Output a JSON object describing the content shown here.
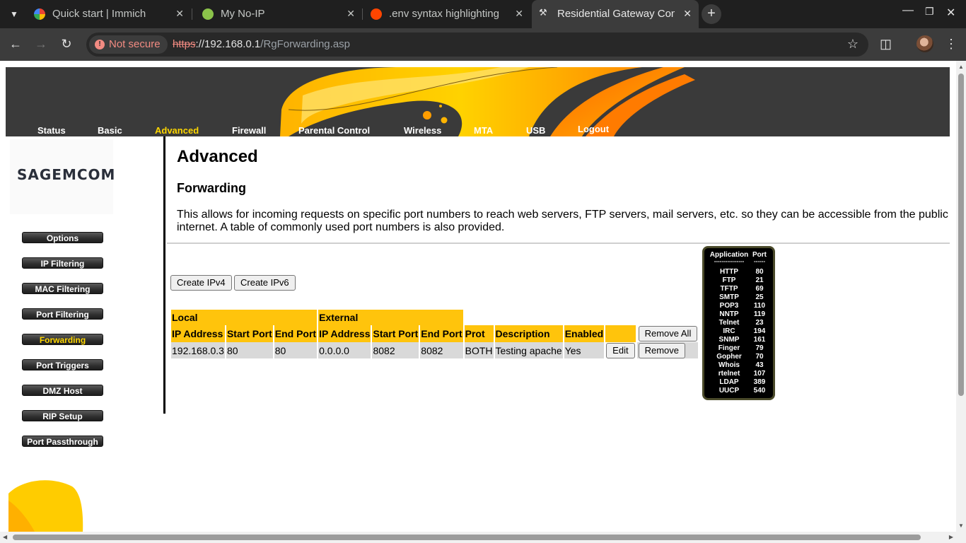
{
  "browser": {
    "tabs": [
      {
        "title": "Quick start | Immich",
        "active": false
      },
      {
        "title": "My No-IP",
        "active": false
      },
      {
        "title": ".env syntax highlighting",
        "active": false
      },
      {
        "title": "Residential Gateway Con",
        "active": true
      }
    ],
    "security_label": "Not secure",
    "url_scheme": "https",
    "url_host": "://192.168.0.1",
    "url_path": "/RgForwarding.asp"
  },
  "topnav": [
    "Status",
    "Basic",
    "Advanced",
    "Firewall",
    "Parental Control",
    "Wireless",
    "MTA",
    "USB",
    "Logout"
  ],
  "topnav_active": "Advanced",
  "logo": "SAGEMCOM",
  "sidenav": [
    "Options",
    "IP Filtering",
    "MAC Filtering",
    "Port Filtering",
    "Forwarding",
    "Port Triggers",
    "DMZ Host",
    "RIP Setup",
    "Port Passthrough"
  ],
  "sidenav_active": "Forwarding",
  "content": {
    "title": "Advanced",
    "subtitle": "Forwarding",
    "description": "This allows for incoming requests on specific port numbers to reach web servers, FTP servers, mail servers, etc. so they can be accessible from the public internet. A table of commonly used port numbers is also provided.",
    "create_ipv4": "Create IPv4",
    "create_ipv6": "Create IPv6"
  },
  "forwarding_table": {
    "group_local": "Local",
    "group_external": "External",
    "columns": [
      "IP Address",
      "Start Port",
      "End Port",
      "IP Address",
      "Start Port",
      "End Port",
      "Prot",
      "Description",
      "Enabled"
    ],
    "remove_all": "Remove All",
    "rows": [
      {
        "local_ip": "192.168.0.3",
        "local_start": "80",
        "local_end": "80",
        "ext_ip": "0.0.0.0",
        "ext_start": "8082",
        "ext_end": "8082",
        "prot": "BOTH",
        "description": "Testing apache",
        "enabled": "Yes",
        "edit": "Edit",
        "remove": "Remove"
      }
    ]
  },
  "common_ports": {
    "header_app": "Application",
    "header_port": "Port",
    "divider_app": "----------------",
    "divider_port": "------",
    "rows": [
      {
        "app": "HTTP",
        "port": "80"
      },
      {
        "app": "FTP",
        "port": "21"
      },
      {
        "app": "TFTP",
        "port": "69"
      },
      {
        "app": "SMTP",
        "port": "25"
      },
      {
        "app": "POP3",
        "port": "110"
      },
      {
        "app": "NNTP",
        "port": "119"
      },
      {
        "app": "Telnet",
        "port": "23"
      },
      {
        "app": "IRC",
        "port": "194"
      },
      {
        "app": "SNMP",
        "port": "161"
      },
      {
        "app": "Finger",
        "port": "79"
      },
      {
        "app": "Gopher",
        "port": "70"
      },
      {
        "app": "Whois",
        "port": "43"
      },
      {
        "app": "rtelnet",
        "port": "107"
      },
      {
        "app": "LDAP",
        "port": "389"
      },
      {
        "app": "UUCP",
        "port": "540"
      }
    ]
  },
  "colors": {
    "accent": "#ffc40c",
    "active_nav": "#ffd700",
    "banner_bg": "#3a3a3a"
  }
}
